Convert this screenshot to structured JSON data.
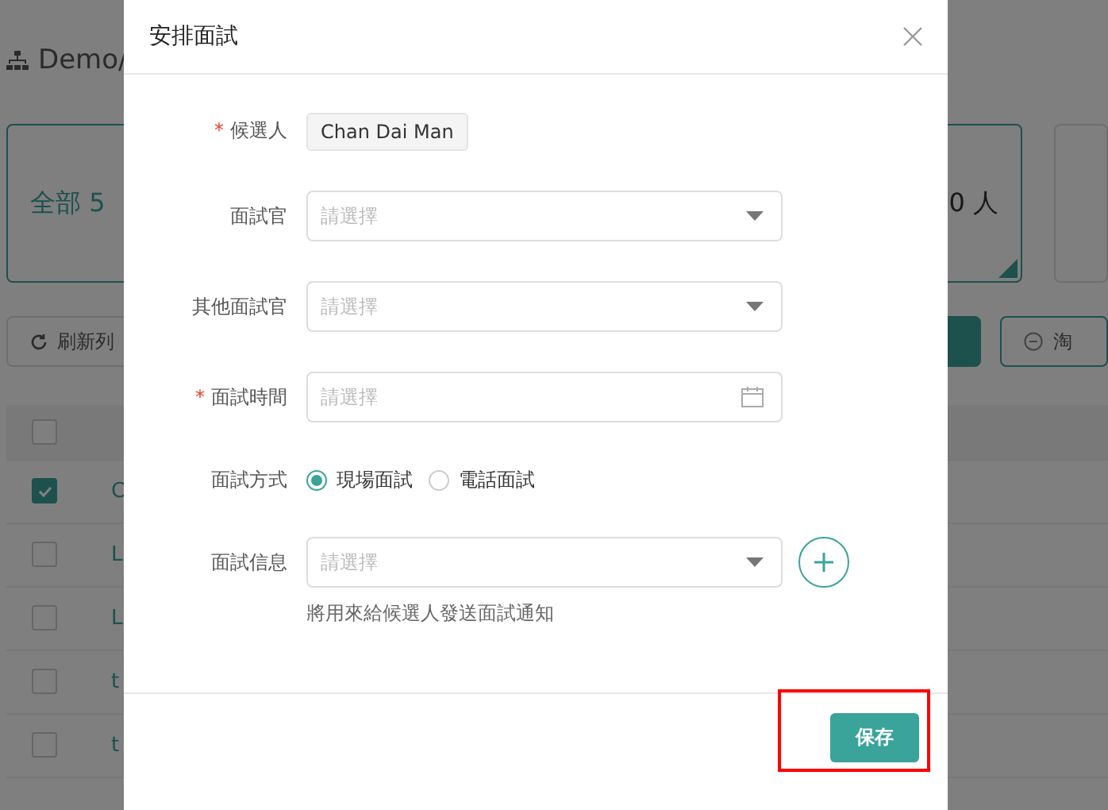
{
  "page": {
    "breadcrumb": "Demo/",
    "summary_card": {
      "texts": [
        "全部 5",
        "0 人"
      ]
    },
    "toolbar": {
      "refresh_button": "刷新列",
      "reject_button": "淘"
    },
    "table": {
      "header": {
        "checked": false
      },
      "rows": [
        {
          "checked": true,
          "text": "C"
        },
        {
          "checked": false,
          "text": "L"
        },
        {
          "checked": false,
          "text": "L"
        },
        {
          "checked": false,
          "text": "t"
        },
        {
          "checked": false,
          "text": "t"
        }
      ]
    }
  },
  "dialog": {
    "title": "安排面試",
    "required_symbol": "*",
    "fields": [
      {
        "kind": "tag",
        "label": "候選人",
        "required": true,
        "value": "Chan Dai Man"
      },
      {
        "kind": "select",
        "label": "面試官",
        "required": false,
        "placeholder": "請選擇"
      },
      {
        "kind": "select",
        "label": "其他面試官",
        "required": false,
        "placeholder": "請選擇"
      },
      {
        "kind": "date",
        "label": "面試時間",
        "required": true,
        "placeholder": "請選擇"
      },
      {
        "kind": "radio",
        "label": "面試方式",
        "required": false,
        "options": [
          {
            "label": "現場面試",
            "selected": true
          },
          {
            "label": "電話面試",
            "selected": false
          }
        ]
      },
      {
        "kind": "select_add",
        "label": "面試信息",
        "required": false,
        "placeholder": "請選擇",
        "hint": "將用來給候選人發送面試通知"
      }
    ],
    "save_button": {
      "label": "保存",
      "highlighted": true
    }
  }
}
